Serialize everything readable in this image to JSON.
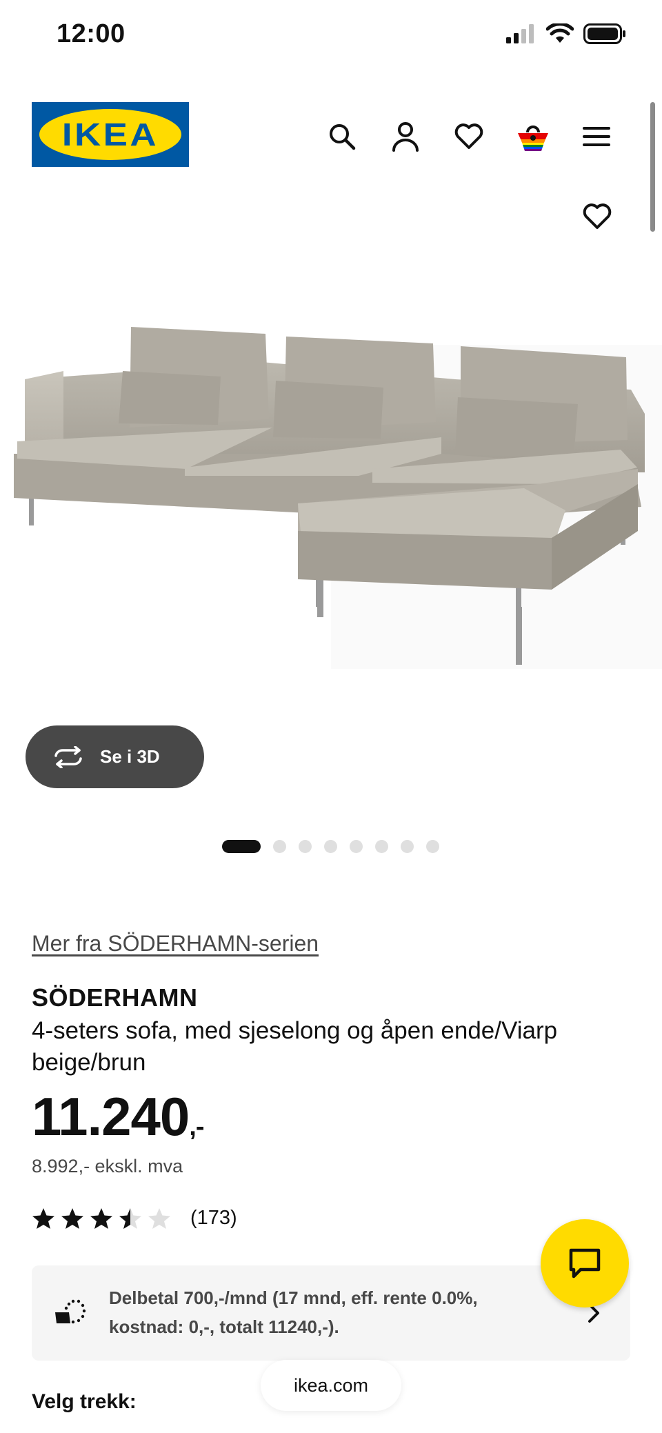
{
  "status_bar": {
    "time": "12:00"
  },
  "header": {
    "logo_text": "IKEA",
    "icons": [
      "search-icon",
      "profile-icon",
      "favorites-icon",
      "cart-icon",
      "menu-icon"
    ]
  },
  "product": {
    "favorite_icon": "heart-icon",
    "view_3d_label": "Se i 3D",
    "carousel": {
      "total": 8,
      "active": 0
    },
    "series_link": "Mer fra SÖDERHAMN-serien",
    "name": "SÖDERHAMN",
    "description": "4-seters sofa, med sjeselong og åpen ende/Viarp beige/brun",
    "price_main": "11.240",
    "price_suffix": ",-",
    "price_excl_vat": "8.992,- ekskl. mva",
    "rating": {
      "value": 3.5,
      "max": 5,
      "count_label": "(173)"
    },
    "financing_text": "Delbetal 700,-/mnd (17 mnd, eff. rente 0.0%, kostnad: 0,-, totalt 11240,-).",
    "cover_label": "Velg trekk:"
  },
  "browser": {
    "url": "ikea.com"
  },
  "colors": {
    "ikea_blue": "#0058a3",
    "ikea_yellow": "#ffdb00",
    "button_dark": "#484848"
  }
}
